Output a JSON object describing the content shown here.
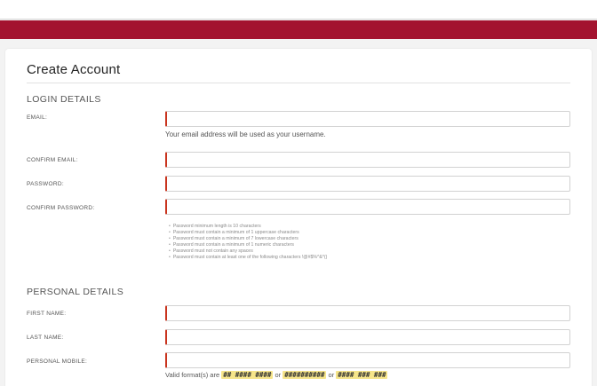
{
  "colors": {
    "brand": "#a3132f",
    "required_marker": "#c9341e",
    "format_highlight": "#f6e58a"
  },
  "page": {
    "title": "Create Account"
  },
  "login": {
    "title": "LOGIN DETAILS",
    "email_label": "EMAIL:",
    "email_help": "Your email address will be used as your username.",
    "confirm_email_label": "CONFIRM EMAIL:",
    "password_label": "PASSWORD:",
    "confirm_password_label": "CONFIRM PASSWORD:",
    "password_rules": [
      "Password minimum length is 10 characters",
      "Password must contain a minimum of 1 uppercase characters",
      "Password must contain a minimum of 7 lowercase characters",
      "Password must contain a minimum of 1 numeric characters",
      "Password must not contain any spaces",
      "Password must contain at least one of the following characters !@#$%^&*()"
    ]
  },
  "personal": {
    "title": "PERSONAL DETAILS",
    "first_name_label": "FIRST NAME:",
    "last_name_label": "LAST NAME:",
    "mobile_label": "PERSONAL MOBILE:",
    "mobile_help_prefix": "Valid format(s) are",
    "mobile_formats": [
      "## #### ####",
      "##########",
      "#### ### ###"
    ],
    "or_word": "or"
  }
}
